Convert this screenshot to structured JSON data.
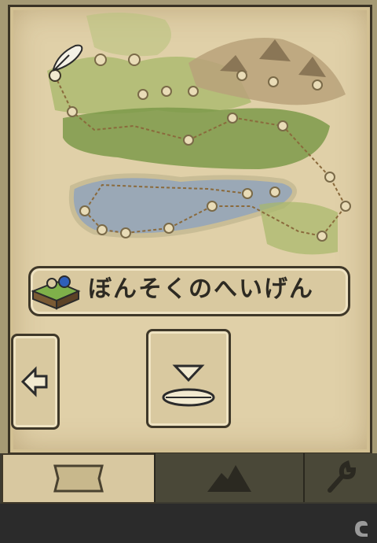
{
  "location": {
    "name": "ぼんそくのへいげん"
  },
  "icons": {
    "quill": "quill-icon",
    "back": "arrow-left-icon",
    "descend": "descend-icon",
    "map_tab": "map-scroll-icon",
    "terrain_tab": "mountain-icon",
    "settings_tab": "wrench-icon"
  },
  "colors": {
    "parchment": "#e0d0a8",
    "water": "#9aa8b6",
    "forest": "#7d9a4a",
    "grass": "#a7b86a",
    "mountain": "#b8a27a",
    "border": "#3f3829"
  }
}
